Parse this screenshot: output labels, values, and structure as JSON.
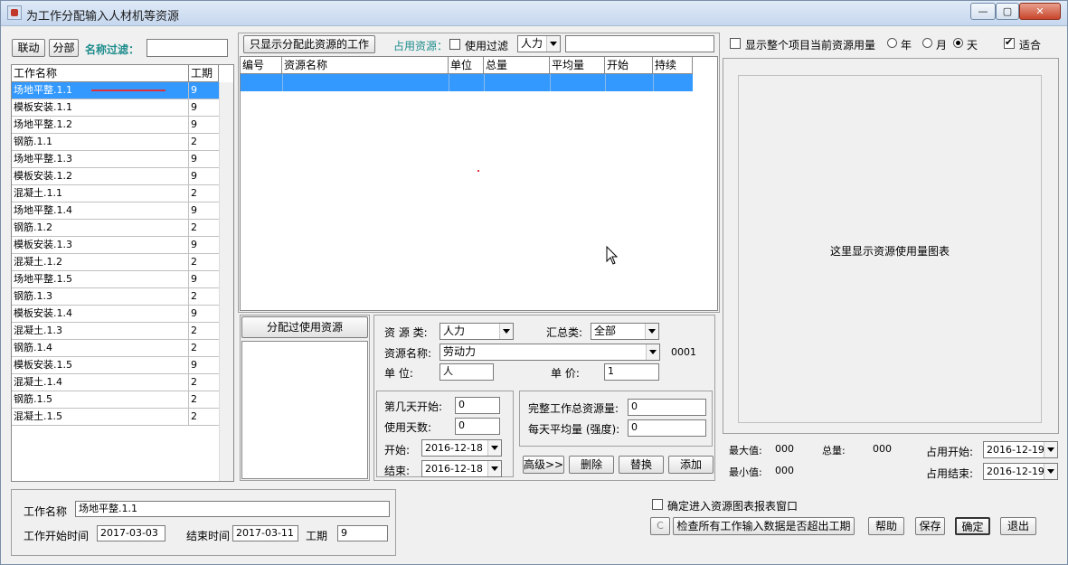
{
  "window": {
    "title": "为工作分配输入人材机等资源",
    "minimize": "—",
    "maximize": "▢",
    "close": "✕"
  },
  "left": {
    "link_button": "联动",
    "split_button": "分部",
    "filter_label": "名称过滤：",
    "filter_value": "",
    "columns": [
      "工作名称",
      "工期"
    ],
    "rows": [
      {
        "name": "场地平整.1.1",
        "duration": "9"
      },
      {
        "name": "模板安装.1.1",
        "duration": "9"
      },
      {
        "name": "场地平整.1.2",
        "duration": "9"
      },
      {
        "name": "钢筋.1.1",
        "duration": "2"
      },
      {
        "name": "场地平整.1.3",
        "duration": "9"
      },
      {
        "name": "模板安装.1.2",
        "duration": "9"
      },
      {
        "name": "混凝土.1.1",
        "duration": "2"
      },
      {
        "name": "场地平整.1.4",
        "duration": "9"
      },
      {
        "name": "钢筋.1.2",
        "duration": "2"
      },
      {
        "name": "模板安装.1.3",
        "duration": "9"
      },
      {
        "name": "混凝土.1.2",
        "duration": "2"
      },
      {
        "name": "场地平整.1.5",
        "duration": "9"
      },
      {
        "name": "钢筋.1.3",
        "duration": "2"
      },
      {
        "name": "模板安装.1.4",
        "duration": "9"
      },
      {
        "name": "混凝土.1.3",
        "duration": "2"
      },
      {
        "name": "钢筋.1.4",
        "duration": "2"
      },
      {
        "name": "模板安装.1.5",
        "duration": "9"
      },
      {
        "name": "混凝土.1.4",
        "duration": "2"
      },
      {
        "name": "钢筋.1.5",
        "duration": "2"
      },
      {
        "name": "混凝土.1.5",
        "duration": "2"
      }
    ],
    "selected_index": 0
  },
  "middle": {
    "show_only_button": "只显示分配此资源的工作",
    "occupy_label": "占用资源：",
    "use_filter_label": "使用过滤",
    "use_filter_checked": false,
    "resource_type_select": "人力",
    "search_value": "",
    "columns": [
      "编号",
      "资源名称",
      "单位",
      "总量",
      "平均量",
      "开始",
      "持续"
    ],
    "assigned_label": "分配过使用资源",
    "resource_class_label": "资 源 类:",
    "resource_class_value": "人力",
    "summary_class_label": "汇总类:",
    "summary_class_value": "全部",
    "resource_name_label": "资源名称:",
    "resource_name_value": "劳动力",
    "resource_code": "0001",
    "unit_label": "单    位:",
    "unit_value": "人",
    "price_label": "单    价:",
    "price_value": "1",
    "start_day_label": "第几天开始:",
    "start_day_value": "0",
    "use_days_label": "使用天数:",
    "use_days_value": "0",
    "start_label": "开始:",
    "start_value": "2016-12-18",
    "end_label": "结束:",
    "end_value": "2016-12-18",
    "total_amount_label": "完整工作总资源量:",
    "total_amount_value": "0",
    "daily_avg_label": "每天平均量 (强度):",
    "daily_avg_value": "0",
    "advanced_button": "高级>>",
    "delete_button": "删除",
    "replace_button": "替换",
    "add_button": "添加"
  },
  "right": {
    "show_all_label": "显示整个项目当前资源用量",
    "show_all_checked": false,
    "year_label": "年",
    "month_label": "月",
    "day_label": "天",
    "period_selected": "天",
    "fit_label": "适合",
    "fit_checked": true,
    "chart_placeholder": "这里显示资源使用量图表",
    "max_label": "最大值:",
    "max_value": "000",
    "total_label": "总量:",
    "total_value": "000",
    "min_label": "最小值:",
    "min_value": "000",
    "occupy_start_label": "占用开始:",
    "occupy_start_value": "2016-12-19",
    "occupy_end_label": "占用结束:",
    "occupy_end_value": "2016-12-19"
  },
  "bottom": {
    "task_name_label": "工作名称",
    "task_name_value": "场地平整.1.1",
    "start_time_label": "工作开始时间",
    "start_time_value": "2017-03-03",
    "end_time_label": "结束时间",
    "end_time_value": "2017-03-11",
    "duration_label": "工期",
    "duration_value": "9",
    "enter_report_label": "确定进入资源图表报表窗口",
    "enter_report_checked": false,
    "c_button": "C",
    "check_button": "检查所有工作输入数据是否超出工期",
    "help_button": "帮助",
    "save_button": "保存",
    "ok_button": "确定",
    "exit_button": "退出"
  },
  "colors": {
    "selection": "#3399ff",
    "filter_label": "#1e8c8c",
    "annotation": "#e0303a"
  }
}
